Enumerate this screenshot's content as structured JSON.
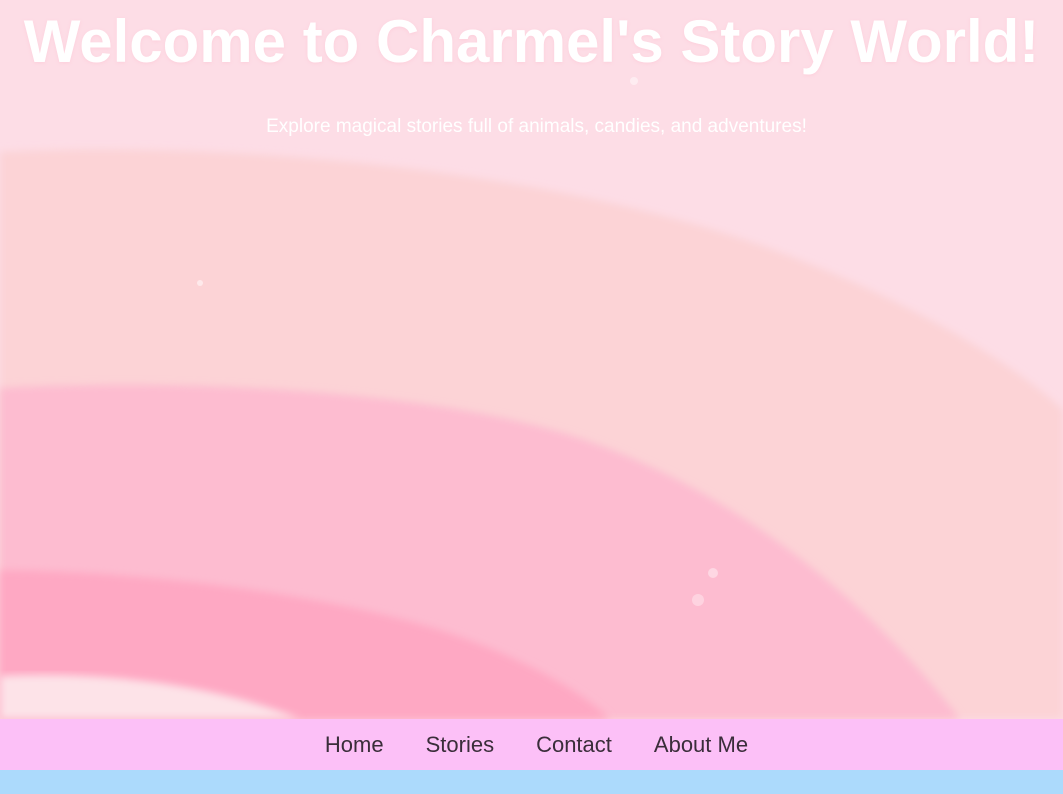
{
  "hero": {
    "title": "Welcome to Charmel's Story World!",
    "subtitle": "Explore magical stories full of animals, candies, and adventures!"
  },
  "nav": {
    "items": [
      {
        "label": "Home"
      },
      {
        "label": "Stories"
      },
      {
        "label": "Contact"
      },
      {
        "label": "About Me"
      }
    ]
  },
  "colors": {
    "hero_background": "#fddde6",
    "rainbow_band_outer": "#fcd3d6",
    "rainbow_band_middle": "#fdbcd0",
    "rainbow_band_inner": "#fea8c3",
    "navbar_background": "#fcc0f7",
    "nav_text": "#3a2d3a",
    "bottom_strip": "#acdafc",
    "title_text": "#ffffff"
  }
}
